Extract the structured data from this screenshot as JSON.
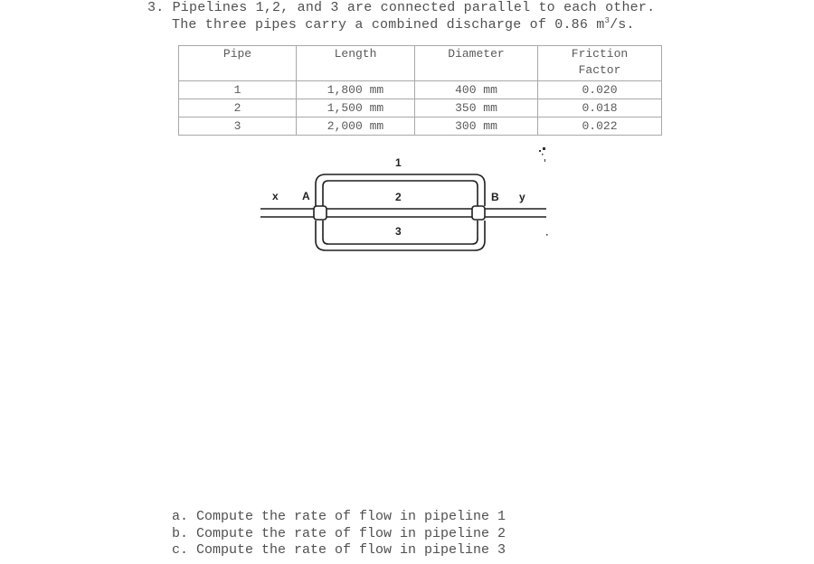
{
  "question": {
    "line1": "3. Pipelines 1,2, and 3 are connected parallel to each other.",
    "line2_prefix": "The three pipes carry a combined discharge of 0.86 m",
    "line2_sup": "3",
    "line2_suffix": "/s."
  },
  "table": {
    "headers": [
      "Pipe",
      "Length",
      "Diameter",
      "Friction\nFactor"
    ],
    "header_friction_line1": "Friction",
    "header_friction_line2": "Factor",
    "rows": [
      {
        "pipe": "1",
        "length": "1,800 mm",
        "diameter": "400 mm",
        "friction": "0.020"
      },
      {
        "pipe": "2",
        "length": "1,500 mm",
        "diameter": "350 mm",
        "friction": "0.018"
      },
      {
        "pipe": "3",
        "length": "2,000 mm",
        "diameter": "300 mm",
        "friction": "0.022"
      }
    ]
  },
  "diagram": {
    "label_pipe1": "1",
    "label_pipe2": "2",
    "label_pipe3": "3",
    "label_x": "x",
    "label_y": "y",
    "label_A": "A",
    "label_B": "B"
  },
  "parts": [
    "a. Compute the rate of flow in pipeline 1",
    "b. Compute the rate of flow in pipeline 2",
    "c. Compute the rate of flow in pipeline 3"
  ]
}
